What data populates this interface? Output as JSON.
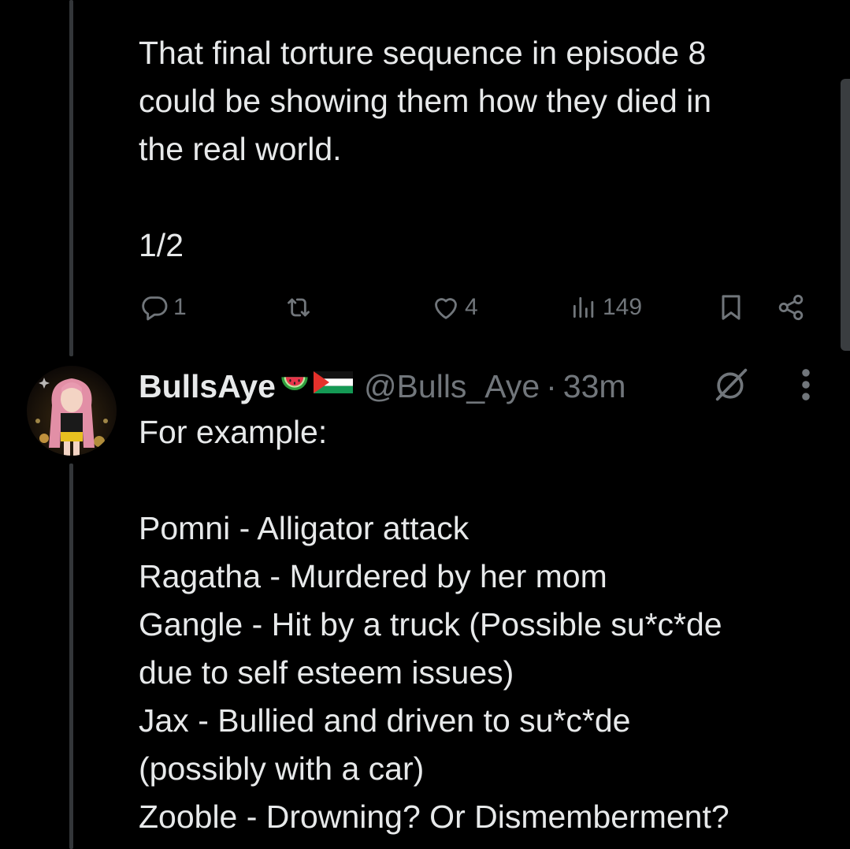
{
  "tweet1": {
    "text": "That final torture sequence in episode 8\ncould be showing them how they died in\nthe real world.\n\n1/2",
    "actions": {
      "reply_count": "1",
      "retweet_count": "",
      "like_count": "4",
      "view_count": "149"
    }
  },
  "tweet2": {
    "author": {
      "display_name": "BullsAye",
      "emojis": [
        "watermelon-emoji",
        "palestine-flag-emoji"
      ],
      "handle": "@Bulls_Aye",
      "separator": "·",
      "time": "33m"
    },
    "text": "For example:\n\nPomni - Alligator attack\nRagatha - Murdered by her mom\nGangle - Hit by a truck (Possible su*c*de\ndue to self esteem issues)\nJax - Bullied and driven to su*c*de\n(possibly with a car)\nZooble - Drowning? Or Dismemberment?"
  },
  "colors": {
    "background": "#000000",
    "text_primary": "#e7e9ea",
    "text_secondary": "#71767b",
    "thread_line": "#333639"
  },
  "icons": [
    "reply-icon",
    "retweet-icon",
    "like-icon",
    "views-icon",
    "bookmark-icon",
    "share-icon",
    "grok-icon",
    "more-icon"
  ]
}
